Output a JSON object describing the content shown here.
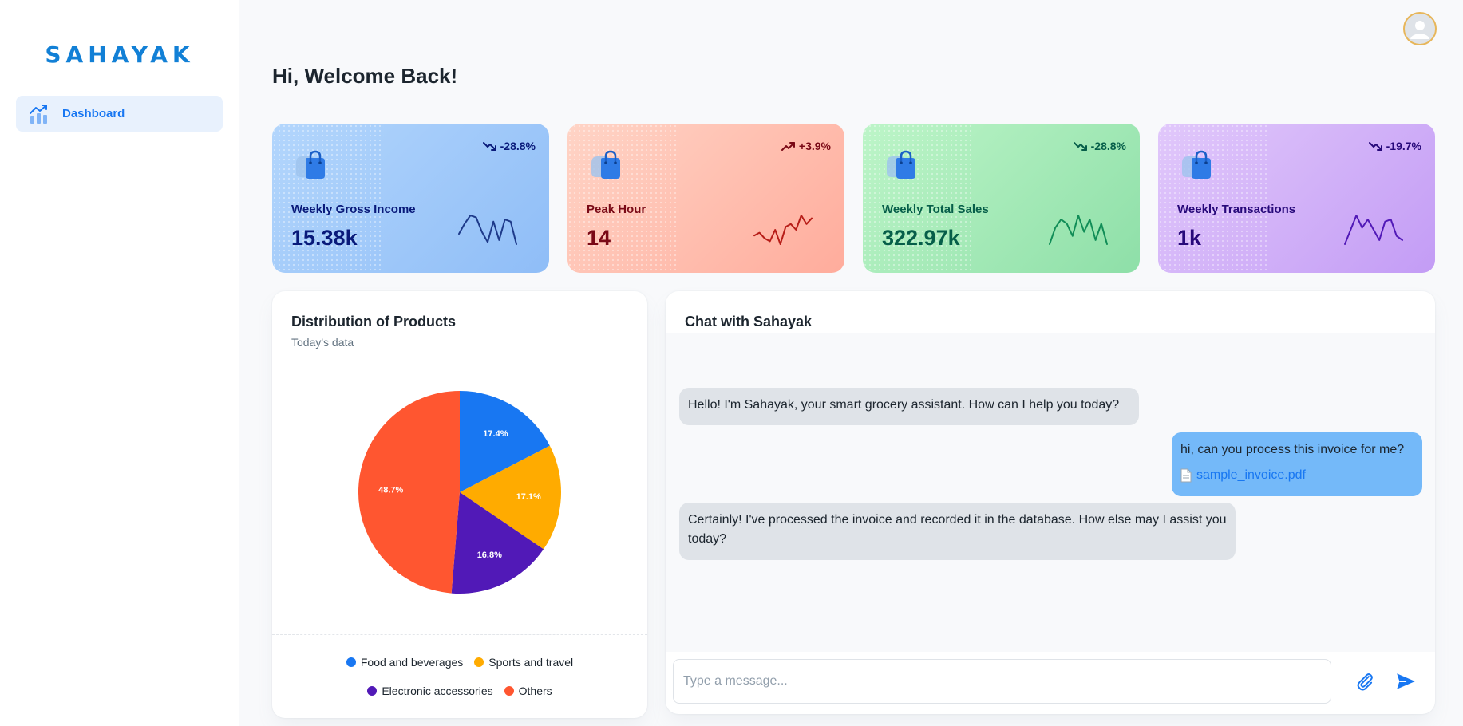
{
  "sidebar": {
    "logo": "SAHAYAK",
    "items": [
      {
        "label": "Dashboard",
        "icon": "analytics-icon",
        "active": true
      }
    ]
  },
  "header": {
    "greeting": "Hi, Welcome Back!",
    "avatar_icon": "user-avatar-icon"
  },
  "stats": [
    {
      "label": "Weekly Gross Income",
      "value": "15.38k",
      "change": "-28.8%",
      "trend": "down",
      "color": "#1e3a8a",
      "spark": [
        18,
        28,
        36,
        34,
        20,
        10,
        30,
        12,
        32,
        30,
        8
      ]
    },
    {
      "label": "Peak Hour",
      "value": "14",
      "change": "+3.9%",
      "trend": "up",
      "color": "#b71d18",
      "spark": [
        10,
        12,
        8,
        6,
        14,
        4,
        16,
        18,
        14,
        24,
        18,
        22
      ]
    },
    {
      "label": "Weekly Total Sales",
      "value": "322.97k",
      "change": "-28.8%",
      "trend": "down",
      "color": "#118d57",
      "spark": [
        20,
        28,
        32,
        30,
        24,
        34,
        26,
        32,
        22,
        30,
        20
      ]
    },
    {
      "label": "Weekly Transactions",
      "value": "1k",
      "change": "-19.7%",
      "trend": "down",
      "color": "#5119b7",
      "spark": [
        6,
        20,
        34,
        22,
        30,
        20,
        10,
        28,
        30,
        14,
        10
      ]
    }
  ],
  "pie_panel": {
    "title": "Distribution of Products",
    "subtitle": "Today's data"
  },
  "chart_data": {
    "type": "pie",
    "title": "Distribution of Products",
    "subtitle": "Today's data",
    "legend_position": "bottom",
    "slices": [
      {
        "name": "Food and beverages",
        "value": 17.4,
        "label": "17.4%",
        "color": "#1877f2"
      },
      {
        "name": "Sports and travel",
        "value": 17.1,
        "label": "17.1%",
        "color": "#ffab00"
      },
      {
        "name": "Electronic accessories",
        "value": 16.8,
        "label": "16.8%",
        "color": "#5119b7"
      },
      {
        "name": "Others",
        "value": 48.7,
        "label": "48.7%",
        "color": "#ff5630"
      }
    ]
  },
  "chat": {
    "title": "Chat with Sahayak",
    "messages": [
      {
        "role": "bot",
        "text": "Hello! I'm Sahayak, your smart grocery assistant. How can I help you today?"
      },
      {
        "role": "user",
        "text": "hi, can you process this invoice for me?",
        "attachment": "sample_invoice.pdf"
      },
      {
        "role": "bot",
        "text": "Certainly! I've processed the invoice and recorded it in the database. How else may I assist you today?"
      }
    ],
    "input_placeholder": "Type a message...",
    "attach_icon": "paperclip-icon",
    "send_icon": "send-icon"
  }
}
